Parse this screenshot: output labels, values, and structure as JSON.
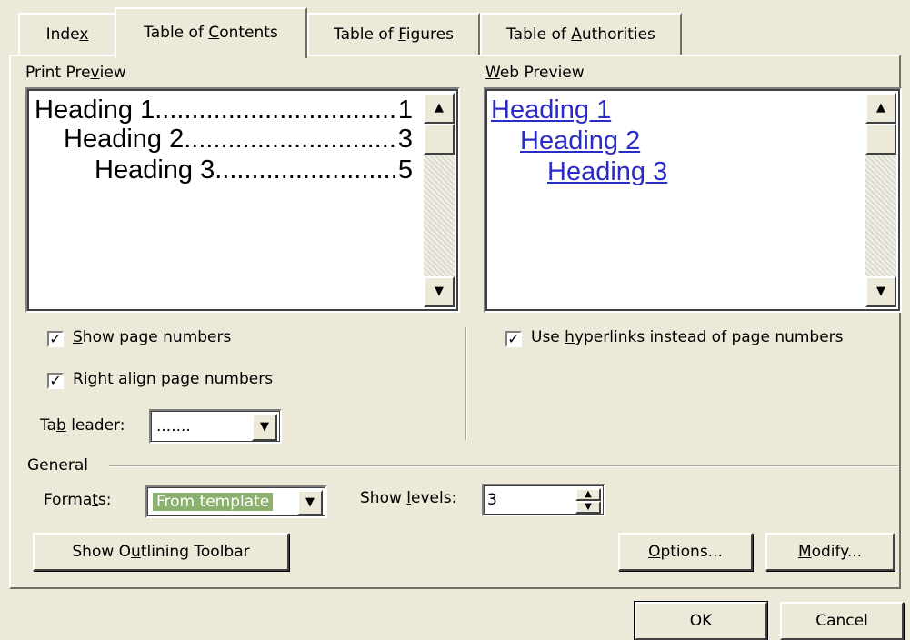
{
  "tabs": [
    {
      "label": "Index",
      "mnemonic": "x",
      "before": "Inde",
      "after": ""
    },
    {
      "label": "Table of Contents",
      "before": "Table of ",
      "mnemonic": "C",
      "after": "ontents"
    },
    {
      "label": "Table of Figures",
      "before": "Table of ",
      "mnemonic": "F",
      "after": "igures"
    },
    {
      "label": "Table of Authorities",
      "before": "Table of ",
      "mnemonic": "A",
      "after": "uthorities"
    }
  ],
  "print_preview": {
    "label": "Print Preview",
    "label_before": "Print Pre",
    "label_mnemonic": "v",
    "label_after": "iew",
    "lines": [
      {
        "text": "Heading 1",
        "page": "1"
      },
      {
        "text": "Heading 2",
        "page": "3"
      },
      {
        "text": "Heading 3",
        "page": "5"
      }
    ]
  },
  "web_preview": {
    "label": "Web Preview",
    "label_mnemonic": "W",
    "label_after": "eb Preview",
    "links": [
      "Heading 1",
      "Heading 2",
      "Heading 3"
    ]
  },
  "options": {
    "show_page_numbers": {
      "checked": true,
      "mnemonic": "S",
      "after": "how page numbers"
    },
    "right_align": {
      "checked": true,
      "mnemonic": "R",
      "after": "ight align page numbers"
    },
    "use_hyperlinks": {
      "checked": true,
      "before": "Use ",
      "mnemonic": "h",
      "after": "yperlinks instead of page numbers"
    },
    "tab_leader": {
      "before": "Ta",
      "mnemonic": "b",
      "after": " leader:",
      "value": "......."
    }
  },
  "general": {
    "label": "General",
    "formats": {
      "before": "Forma",
      "mnemonic": "t",
      "after": "s:",
      "value": "From template"
    },
    "show_levels": {
      "before": "Show ",
      "mnemonic": "l",
      "after": "evels:",
      "value": "3"
    }
  },
  "buttons": {
    "show_outlining": {
      "before": "Show O",
      "mnemonic": "u",
      "after": "tlining Toolbar"
    },
    "options": {
      "mnemonic": "O",
      "after": "ptions..."
    },
    "modify": {
      "mnemonic": "M",
      "after": "odify..."
    },
    "ok": "OK",
    "cancel": "Cancel"
  }
}
